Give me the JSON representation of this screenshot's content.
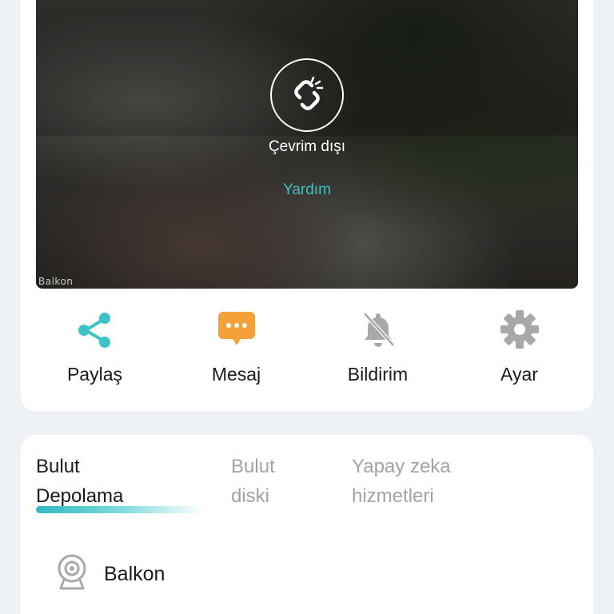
{
  "camera": {
    "status_text": "Çevrim dışı",
    "help_link": "Yardım",
    "watermark": "Balkon",
    "status_icon": "broken-link-icon"
  },
  "actions": [
    {
      "label": "Paylaş",
      "icon": "share-icon",
      "color": "#3cc3c8"
    },
    {
      "label": "Mesaj",
      "icon": "message-icon",
      "color": "#f5a13a"
    },
    {
      "label": "Bildirim",
      "icon": "bell-off-icon",
      "color": "#a8a8a8"
    },
    {
      "label": "Ayar",
      "icon": "gear-icon",
      "color": "#a8a8a8"
    }
  ],
  "tabs": [
    {
      "label_line1": "Bulut",
      "label_line2": "Depolama",
      "active": true
    },
    {
      "label_line1": "Bulut",
      "label_line2": "diski",
      "active": false
    },
    {
      "label_line1": "Yapay zeka",
      "label_line2": "hizmetleri",
      "active": false
    }
  ],
  "device": {
    "name": "Balkon",
    "icon": "camera-icon"
  },
  "colors": {
    "accent": "#3cc3c8",
    "message": "#f5a13a",
    "inactive": "#a8a8a8"
  }
}
